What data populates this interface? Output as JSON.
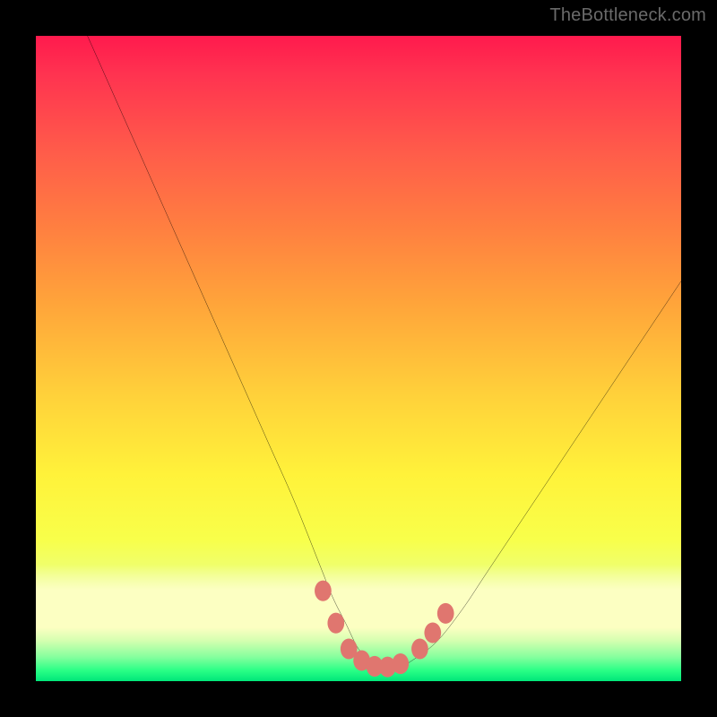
{
  "watermark": "TheBottleneck.com",
  "chart_data": {
    "type": "line",
    "title": "",
    "xlabel": "",
    "ylabel": "",
    "xlim": [
      0,
      100
    ],
    "ylim": [
      0,
      100
    ],
    "grid": false,
    "legend": false,
    "annotations": [],
    "series": [
      {
        "name": "curve",
        "x": [
          8,
          12,
          16,
          20,
          24,
          28,
          32,
          36,
          40,
          44,
          46,
          48,
          50,
          52,
          54,
          56,
          58,
          62,
          66,
          70,
          74,
          78,
          82,
          86,
          90,
          94,
          98,
          100
        ],
        "values": [
          100,
          91,
          82,
          73,
          64,
          55,
          46,
          37,
          28,
          18,
          13,
          9,
          5,
          3,
          2,
          2,
          3,
          6,
          11,
          17,
          23,
          29,
          35,
          41,
          47,
          53,
          59,
          62
        ]
      }
    ],
    "markers": {
      "name": "bottom-dots",
      "color": "#e0766f",
      "points": [
        {
          "x": 44.5,
          "y": 14
        },
        {
          "x": 46.5,
          "y": 9
        },
        {
          "x": 48.5,
          "y": 5
        },
        {
          "x": 50.5,
          "y": 3.2
        },
        {
          "x": 52.5,
          "y": 2.3
        },
        {
          "x": 54.5,
          "y": 2.2
        },
        {
          "x": 56.5,
          "y": 2.7
        },
        {
          "x": 59.5,
          "y": 5
        },
        {
          "x": 61.5,
          "y": 7.5
        },
        {
          "x": 63.5,
          "y": 10.5
        }
      ]
    },
    "background_gradient": {
      "top": "#ff1a4d",
      "mid1": "#ffa63a",
      "mid2": "#fff23a",
      "pale": "#fcffc2",
      "bottom": "#00e67a"
    }
  }
}
